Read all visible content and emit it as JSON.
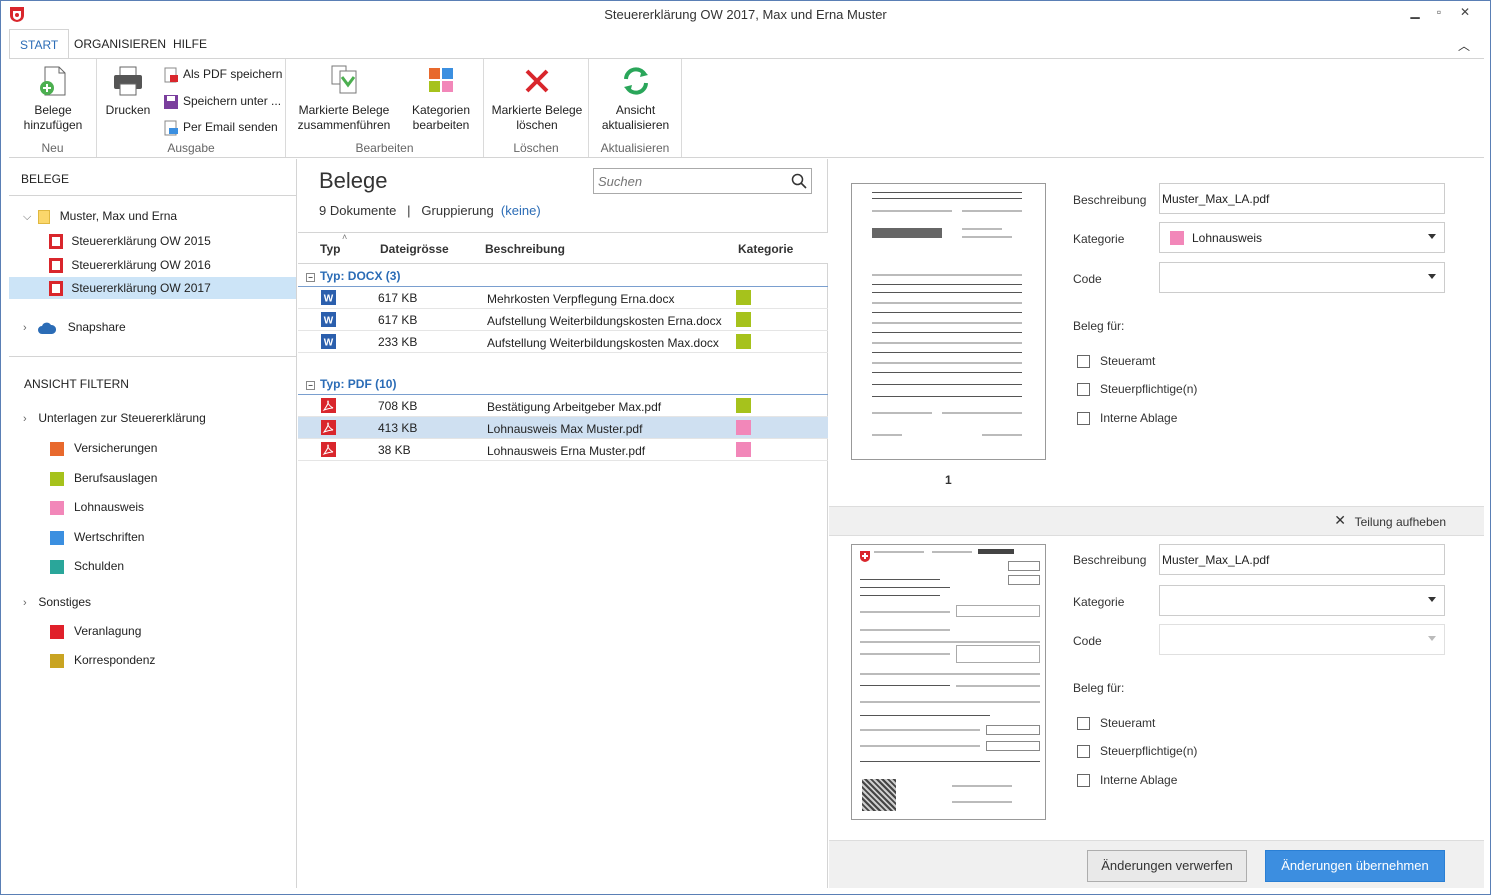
{
  "window": {
    "title": "Steuererklärung OW 2017, Max und Erna Muster"
  },
  "tabs": [
    {
      "label": "START",
      "active": true
    },
    {
      "label": "ORGANISIEREN",
      "active": false
    },
    {
      "label": "HILFE",
      "active": false
    }
  ],
  "ribbon": {
    "groups": {
      "neu": "Neu",
      "ausgabe": "Ausgabe",
      "bearbeiten": "Bearbeiten",
      "loeschen": "Löschen",
      "aktualisieren": "Aktualisieren"
    },
    "add_docs": "Belege hinzufügen",
    "print": "Drucken",
    "save_pdf": "Als PDF speichern",
    "save_as": "Speichern unter ...",
    "send_email": "Per Email senden",
    "merge": "Markierte Belege zusammenführen",
    "edit_categories": "Kategorien bearbeiten",
    "delete": "Markierte Belege löschen",
    "refresh": "Ansicht aktualisieren"
  },
  "left": {
    "belege_heading": "BELEGE",
    "tree": {
      "root": "Muster, Max und Erna",
      "items": [
        "Steuererklärung OW 2015",
        "Steuererklärung OW 2016",
        "Steuererklärung OW 2017"
      ],
      "snapshare": "Snapshare"
    },
    "filter_heading": "ANSICHT FILTERN",
    "filter_group1": "Unterlagen zur Steuererklärung",
    "filter_group1_items": [
      {
        "label": "Versicherungen",
        "color": "#e8692d"
      },
      {
        "label": "Berufsauslagen",
        "color": "#a6c21c"
      },
      {
        "label": "Lohnausweis",
        "color": "#f287b9"
      },
      {
        "label": "Wertschriften",
        "color": "#3b8fe0"
      },
      {
        "label": "Schulden",
        "color": "#2aa69a"
      }
    ],
    "filter_group2": "Sonstiges",
    "filter_group2_items": [
      {
        "label": "Veranlagung",
        "color": "#e0202a"
      },
      {
        "label": "Korrespondenz",
        "color": "#c9a422"
      }
    ]
  },
  "middle": {
    "title": "Belege",
    "doc_count": "9 Dokumente",
    "separator": "|",
    "grouping_label": "Gruppierung",
    "grouping_value": "(keine)",
    "search_placeholder": "Suchen",
    "columns": {
      "typ": "Typ",
      "size": "Dateigrösse",
      "desc": "Beschreibung",
      "cat": "Kategorie"
    },
    "groups": [
      {
        "label": "Typ: DOCX (3)",
        "rows": [
          {
            "icon": "word-icon",
            "size": "617 KB",
            "desc": "Mehrkosten Verpflegung Erna.docx",
            "color": "#a6c21c"
          },
          {
            "icon": "word-icon",
            "size": "617 KB",
            "desc": "Aufstellung Weiterbildungskosten Erna.docx",
            "color": "#a6c21c"
          },
          {
            "icon": "word-icon",
            "size": "233 KB",
            "desc": "Aufstellung Weiterbildungskosten Max.docx",
            "color": "#a6c21c"
          }
        ]
      },
      {
        "label": "Typ: PDF (10)",
        "rows": [
          {
            "icon": "pdf-icon",
            "size": "708 KB",
            "desc": "Bestätigung Arbeitgeber Max.pdf",
            "color": "#a6c21c"
          },
          {
            "icon": "pdf-icon",
            "size": "413 KB",
            "desc": "Lohnausweis Max Muster.pdf",
            "color": "#f287b9",
            "selected": true
          },
          {
            "icon": "pdf-icon",
            "size": "38 KB",
            "desc": "Lohnausweis Erna Muster.pdf",
            "color": "#f287b9"
          }
        ]
      }
    ]
  },
  "right": {
    "top": {
      "desc_label": "Beschreibung",
      "desc_value": "Muster_Max_LA.pdf",
      "cat_label": "Kategorie",
      "cat_value": "Lohnausweis",
      "code_label": "Code",
      "for_label": "Beleg für:",
      "checks": [
        "Steueramt",
        "Steuerpflichtige(n)",
        "Interne Ablage"
      ],
      "page": "1"
    },
    "split_label": "Teilung aufheben",
    "bottom": {
      "desc_label": "Beschreibung",
      "desc_value": "Muster_Max_LA.pdf",
      "cat_label": "Kategorie",
      "code_label": "Code",
      "for_label": "Beleg für:",
      "checks": [
        "Steueramt",
        "Steuerpflichtige(n)",
        "Interne Ablage"
      ]
    },
    "discard": "Änderungen verwerfen",
    "apply": "Änderungen übernehmen"
  }
}
